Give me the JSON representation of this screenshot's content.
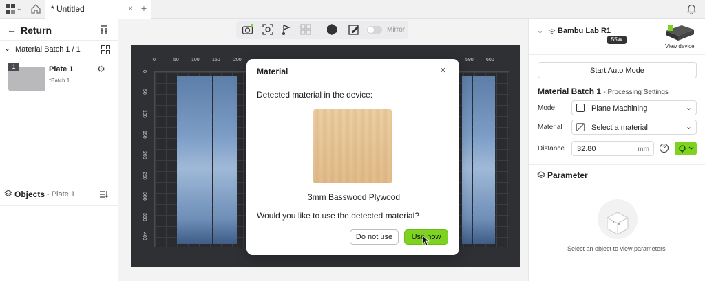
{
  "titlebar": {
    "tab_title": "* Untitled",
    "close_glyph": "×",
    "plus_glyph": "+"
  },
  "left": {
    "return_label": "Return",
    "batch_title": "Material Batch 1 / 1",
    "plate_number": "1",
    "plate_name": "Plate 1",
    "plate_sub": "*Batch 1",
    "objects_label": "Objects",
    "objects_plate": "- Plate 1"
  },
  "toolbar": {
    "mirror_label": "Mirror"
  },
  "canvas": {
    "ruler_x": [
      "0",
      "50",
      "100",
      "150",
      "200",
      "590",
      "600"
    ],
    "ruler_y": [
      "0",
      "50",
      "100",
      "150",
      "200",
      "250",
      "300",
      "350",
      "400"
    ]
  },
  "dialog": {
    "title": "Material",
    "detected_text": "Detected material in the device:",
    "material_name": "3mm Basswood Plywood",
    "question": "Would you like to use the detected material?",
    "do_not_use_label": "Do not use",
    "use_now_label": "Use now"
  },
  "right": {
    "device_name": "Bambu Lab R1",
    "power_badge": "55W",
    "view_device_label": "View device",
    "start_auto_label": "Start Auto Mode",
    "batch_title": "Material Batch 1",
    "batch_sub": "- Processing Settings",
    "mode_label": "Mode",
    "mode_value": "Plane Machining",
    "material_label": "Material",
    "material_value": "Select a material",
    "distance_label": "Distance",
    "distance_value": "32.80",
    "distance_unit": "mm",
    "parameter_label": "Parameter",
    "empty_hint": "Select an object to view parameters"
  },
  "colors": {
    "accent_green": "#7ed321",
    "board_blue": "#6f8fb8",
    "wood": "#e7c79a"
  }
}
